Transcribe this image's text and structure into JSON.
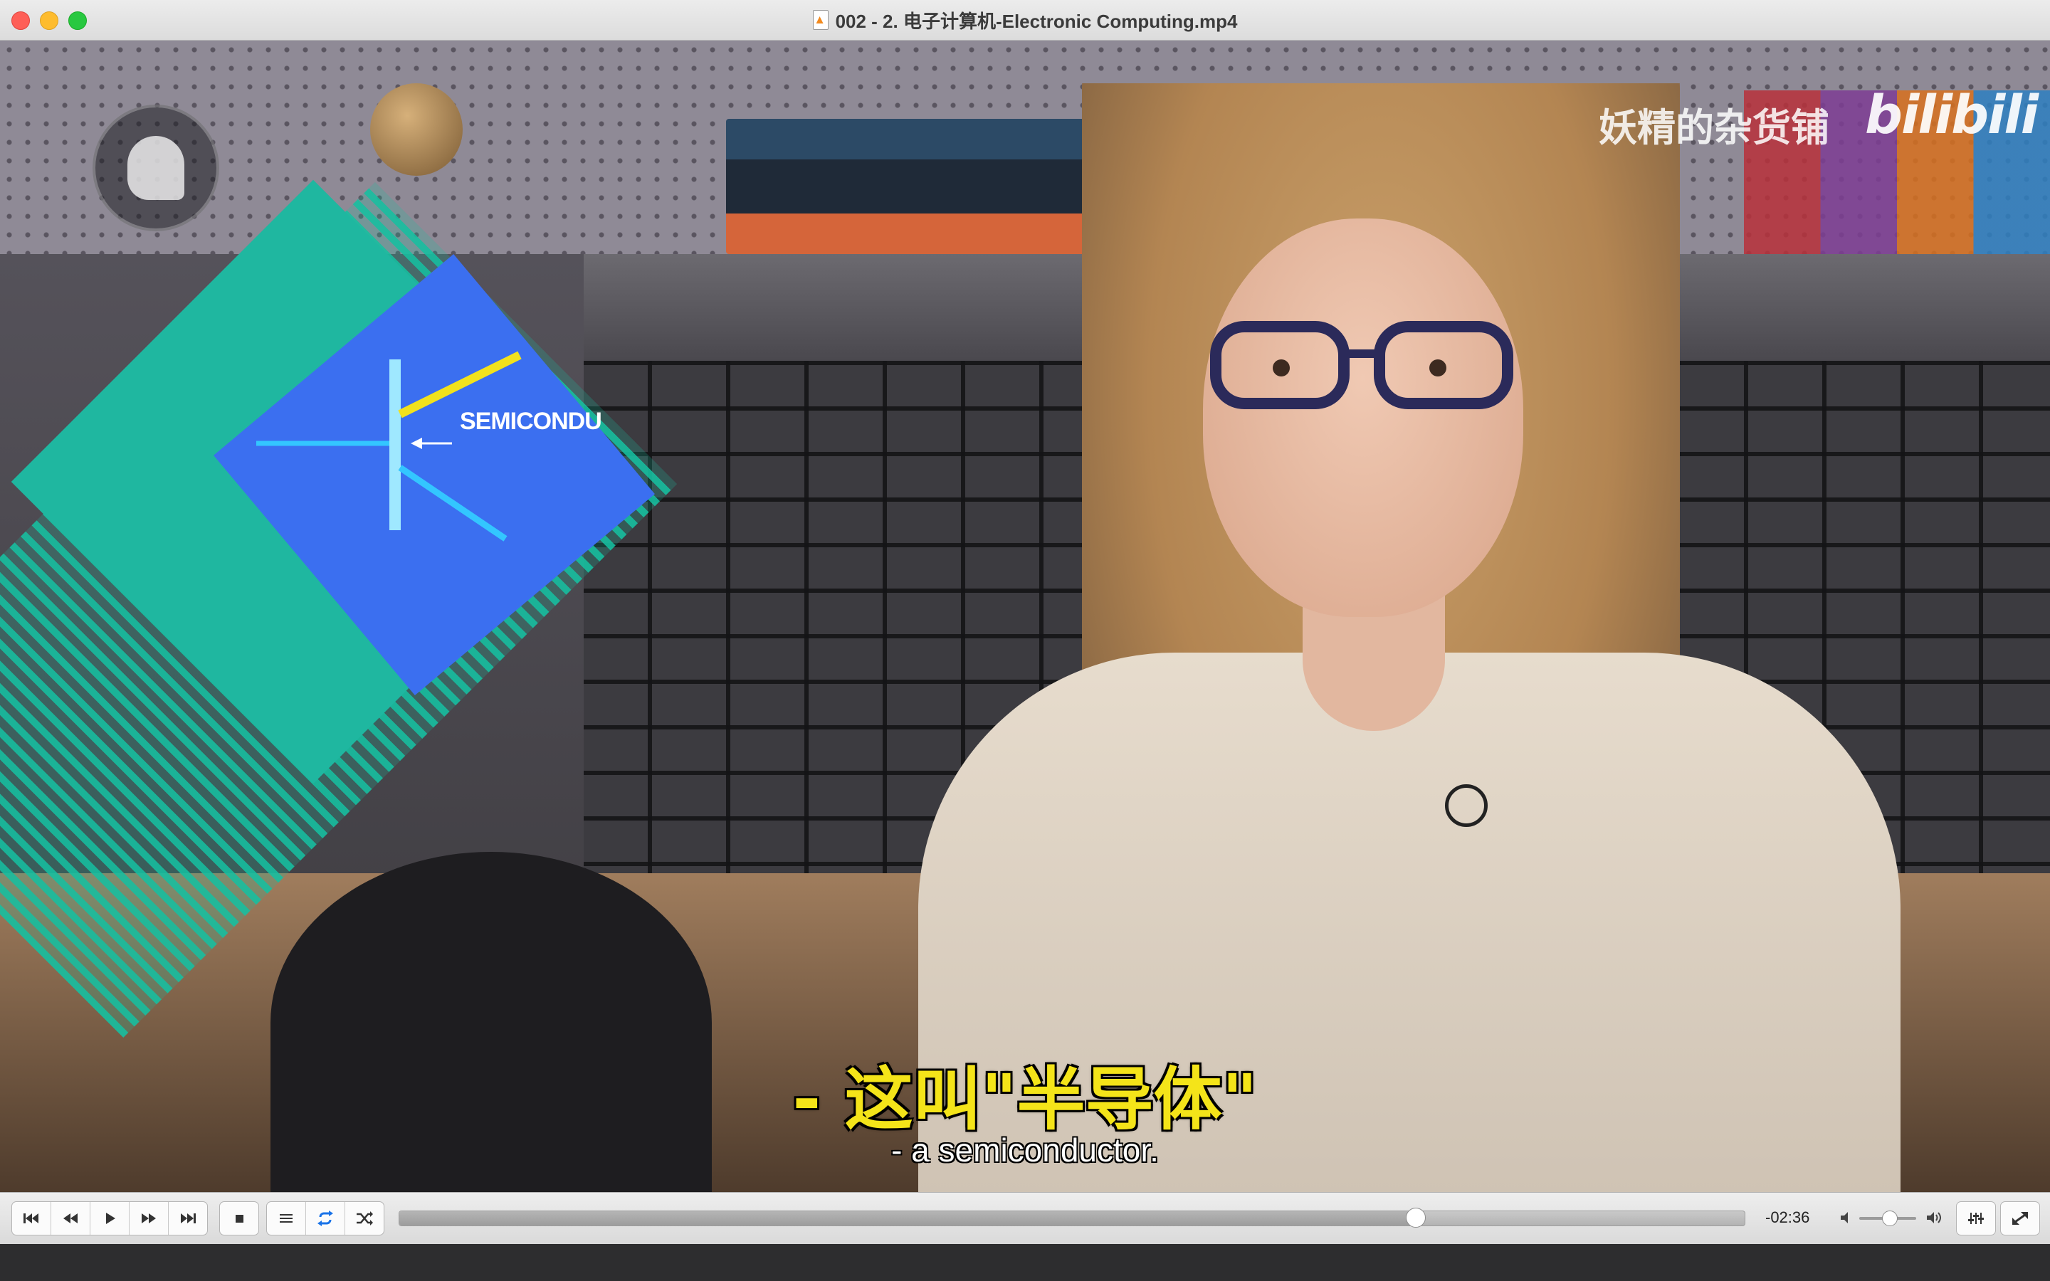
{
  "window": {
    "title": "002 - 2. 电子计算机-Electronic Computing.mp4"
  },
  "video": {
    "watermark_text": "妖精的杂货铺",
    "watermark_logo": "bilibili",
    "diagram_label": "SEMICONDU",
    "subtitle_cn": "- 这叫\"半导体\"",
    "subtitle_en": "- a semiconductor."
  },
  "controls": {
    "transport_buttons": [
      "skip-to-start",
      "rewind",
      "play",
      "fast-forward",
      "skip-to-end"
    ],
    "stop_button": "stop",
    "toggle_buttons": [
      "playlist",
      "repeat",
      "shuffle"
    ],
    "progress_fraction": 0.755,
    "time_remaining": "-02:36",
    "volume_fraction": 0.52,
    "accent_color": "#1a73e8"
  }
}
